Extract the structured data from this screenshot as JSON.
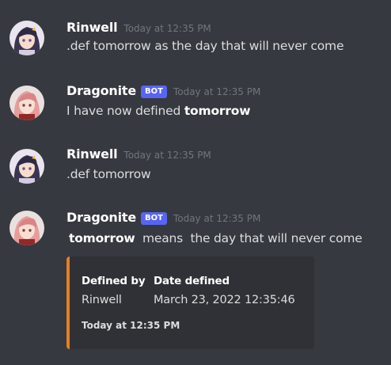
{
  "messages": [
    {
      "username": "Rinwell",
      "timestamp": "Today at 12:35 PM",
      "text": ".def tomorrow as the day that will never come"
    },
    {
      "username": "Dragonite",
      "bot_tag": "BOT",
      "timestamp": "Today at 12:35 PM",
      "text_prefix": "I have now defined ",
      "text_bold": "tomorrow"
    },
    {
      "username": "Rinwell",
      "timestamp": "Today at 12:35 PM",
      "text": ".def tomorrow"
    },
    {
      "username": "Dragonite",
      "bot_tag": "BOT",
      "timestamp": "Today at 12:35 PM",
      "text_bold": "tomorrow",
      "text_suffix": "  means  the day that will never come",
      "embed": {
        "accent_color": "#e67e22",
        "fields": [
          {
            "name": "Defined by",
            "value": "Rinwell"
          },
          {
            "name": "Date defined",
            "value": "March 23, 2022 12:35:46"
          }
        ],
        "footer": "Today at 12:35 PM"
      }
    }
  ],
  "colors": {
    "background": "#36393f",
    "bot_tag": "#5865f2",
    "embed_background": "#2f3136"
  },
  "icons": {
    "rinwell_avatar": "anime-girl-dark-hair-avatar",
    "dragonite_avatar": "anime-girl-pink-hair-avatar"
  }
}
